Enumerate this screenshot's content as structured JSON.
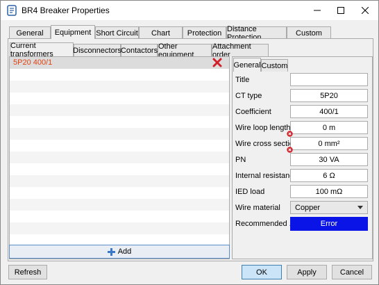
{
  "window": {
    "title": "BR4 Breaker Properties"
  },
  "main_tabs": [
    "General",
    "Equipment",
    "Short Circuit",
    "Chart",
    "Protection",
    "Distance Protection",
    "Custom"
  ],
  "sub_tabs": [
    "Current transformers",
    "Disconnectors",
    "Contactors",
    "Other equipment",
    "Attachment order"
  ],
  "list": {
    "items": [
      "5P20 400/1"
    ],
    "add_label": "Add"
  },
  "props": {
    "tabs": [
      "General",
      "Custom"
    ],
    "rows": [
      {
        "label": "Title",
        "value": ""
      },
      {
        "label": "CT type",
        "value": "5P20"
      },
      {
        "label": "Coefficient",
        "value": "400/1"
      },
      {
        "label": "Wire loop length",
        "value": "0 m"
      },
      {
        "label": "Wire cross section",
        "value": "0 mm²"
      },
      {
        "label": "PN",
        "value": "30 VA"
      },
      {
        "label": "Internal resistance",
        "value": "6 Ω"
      },
      {
        "label": "IED load",
        "value": "100 mΩ"
      },
      {
        "label": "Wire material",
        "value": "Copper"
      },
      {
        "label": "Recommended ...",
        "value": "Error"
      }
    ]
  },
  "buttons": {
    "refresh": "Refresh",
    "ok": "OK",
    "apply": "Apply",
    "cancel": "Cancel"
  },
  "colors": {
    "accent": "#0a14e6",
    "list_text": "#e04010",
    "delete": "#d0202a"
  }
}
